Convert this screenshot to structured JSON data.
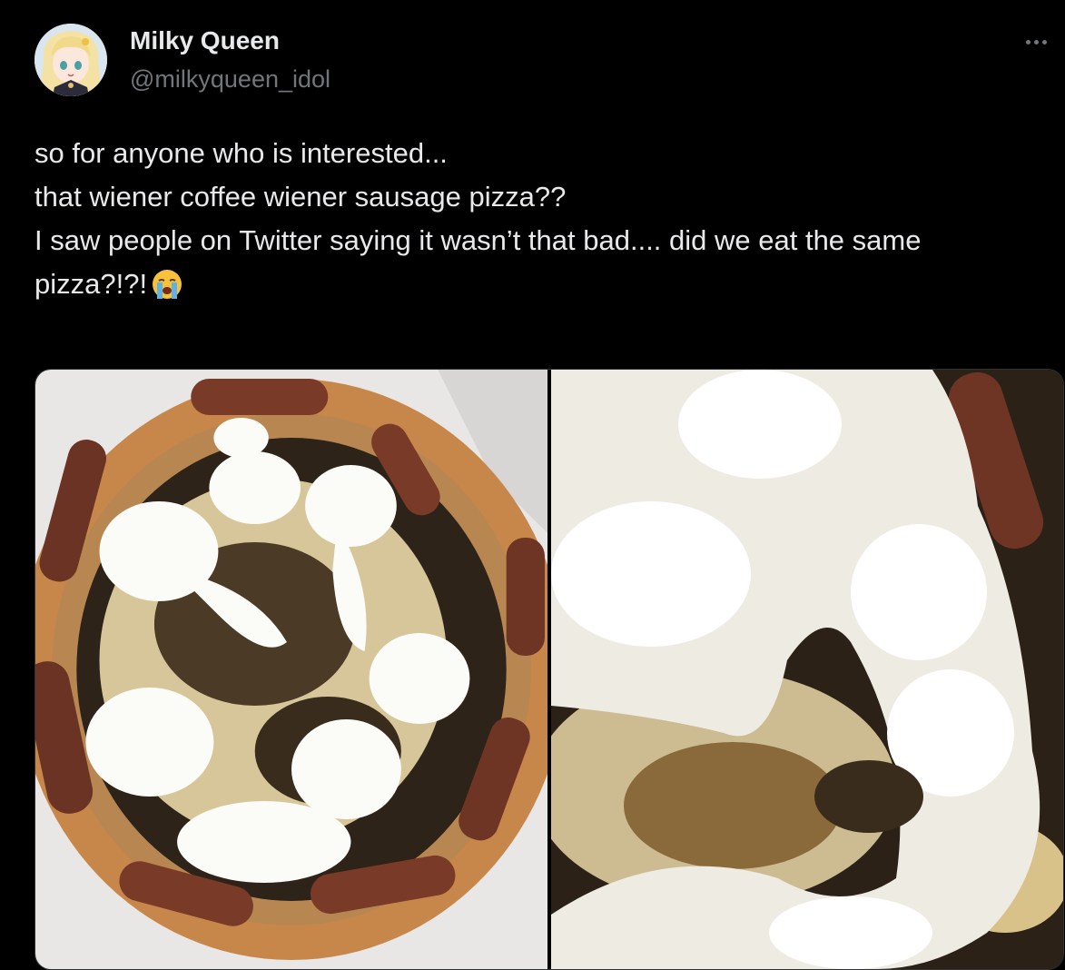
{
  "user": {
    "display_name": "Milky Queen",
    "handle": "@milkyqueen_idol",
    "avatar_icon": "anime-girl-avatar"
  },
  "post": {
    "lines": [
      "so for anyone who is interested...",
      "that wiener coffee wiener sausage pizza??",
      "",
      "I saw people on Twitter saying it wasn’t that bad.... did we eat the same",
      "pizza?!?!"
    ],
    "emoji": "loudly-crying-face-icon"
  },
  "media": {
    "photos": [
      {
        "subject": "pizza-whole-photo",
        "icon": "pizza-photo-icon"
      },
      {
        "subject": "pizza-closeup-photo",
        "icon": "pizza-photo-icon"
      }
    ]
  },
  "colors": {
    "background": "#000000",
    "text": "#e7e9ea",
    "secondary": "#71767b",
    "border": "#2f3336"
  }
}
